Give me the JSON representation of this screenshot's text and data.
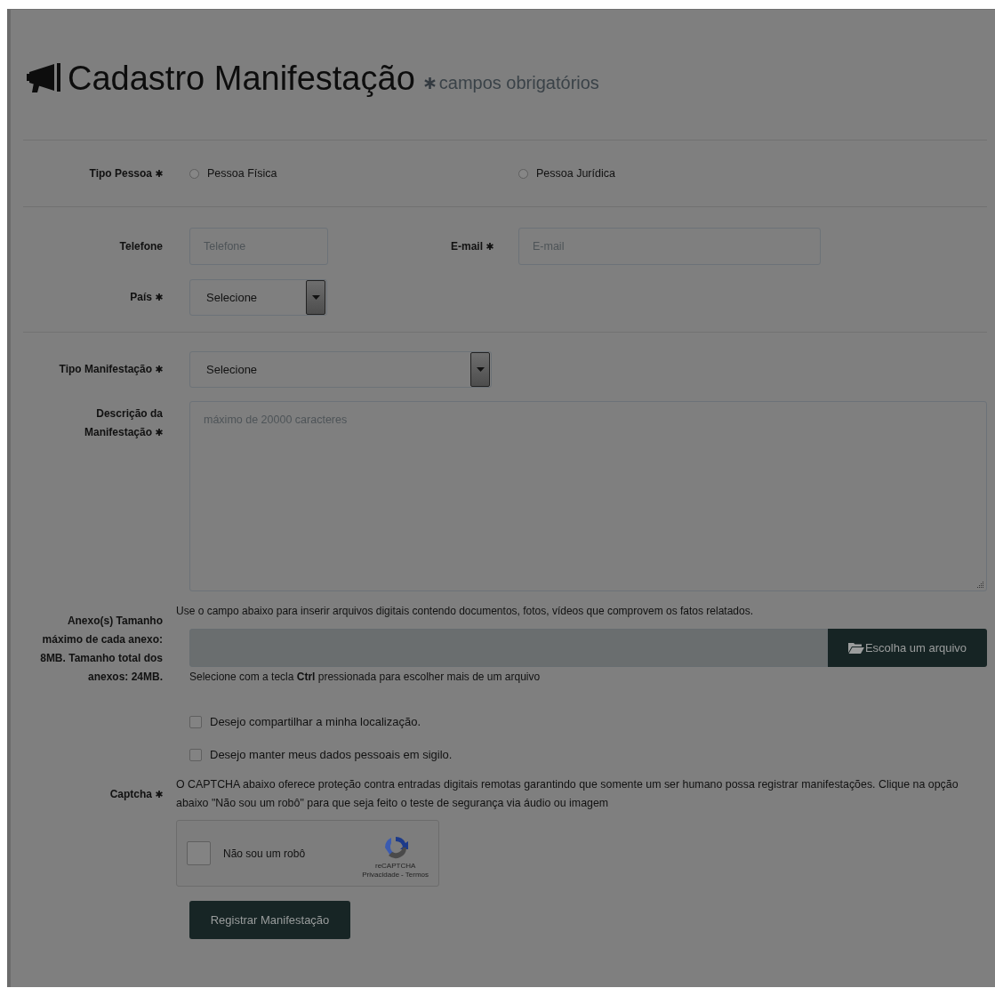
{
  "title": "Cadastro Manifestação",
  "required_note": "campos obrigatórios",
  "tipo_pessoa": {
    "label": "Tipo Pessoa",
    "required": true,
    "options": [
      {
        "label": "Pessoa Física",
        "selected": false
      },
      {
        "label": "Pessoa Jurídica",
        "selected": false
      }
    ]
  },
  "telefone": {
    "label": "Telefone",
    "required": false,
    "placeholder": "Telefone"
  },
  "email": {
    "label": "E-mail",
    "required": true,
    "placeholder": "E-mail"
  },
  "pais": {
    "label": "País",
    "required": true,
    "value": "Selecione"
  },
  "tipo_manifestacao": {
    "label": "Tipo Manifestação",
    "required": true,
    "value": "Selecione"
  },
  "descricao": {
    "label": "Descrição da Manifestação",
    "required": true,
    "placeholder": "máximo de 20000 caracteres"
  },
  "anexos": {
    "label": "Anexo(s) Tamanho máximo de cada anexo: 8MB. Tamanho total dos anexos: 24MB.",
    "help": "Use o campo abaixo para inserir arquivos digitais contendo documentos, fotos, vídeos que comprovem os fatos relatados.",
    "button": "Escolha um arquivo",
    "hint": "Selecione com a tecla **Ctrl** pressionada para escolher mais de um arquivo"
  },
  "checkboxes": [
    {
      "label": "Desejo compartilhar a minha localização.",
      "checked": false
    },
    {
      "label": "Desejo manter meus dados pessoais em sigilo.",
      "checked": false
    }
  ],
  "captcha": {
    "label": "Captcha",
    "required": true,
    "text": "O CAPTCHA abaixo oferece proteção contra entradas digitais remotas garantindo que somente um ser humano possa registrar manifestações. Clique na opção abaixo \"Não sou um robô\" para que seja feito o teste de segurança via áudio ou imagem",
    "widget": {
      "label": "Não sou um robô",
      "checked": false,
      "brand": "reCAPTCHA",
      "privacy": "Privacidade",
      "separator": "-",
      "terms": "Termos"
    }
  },
  "submit": "Registrar Manifestação"
}
